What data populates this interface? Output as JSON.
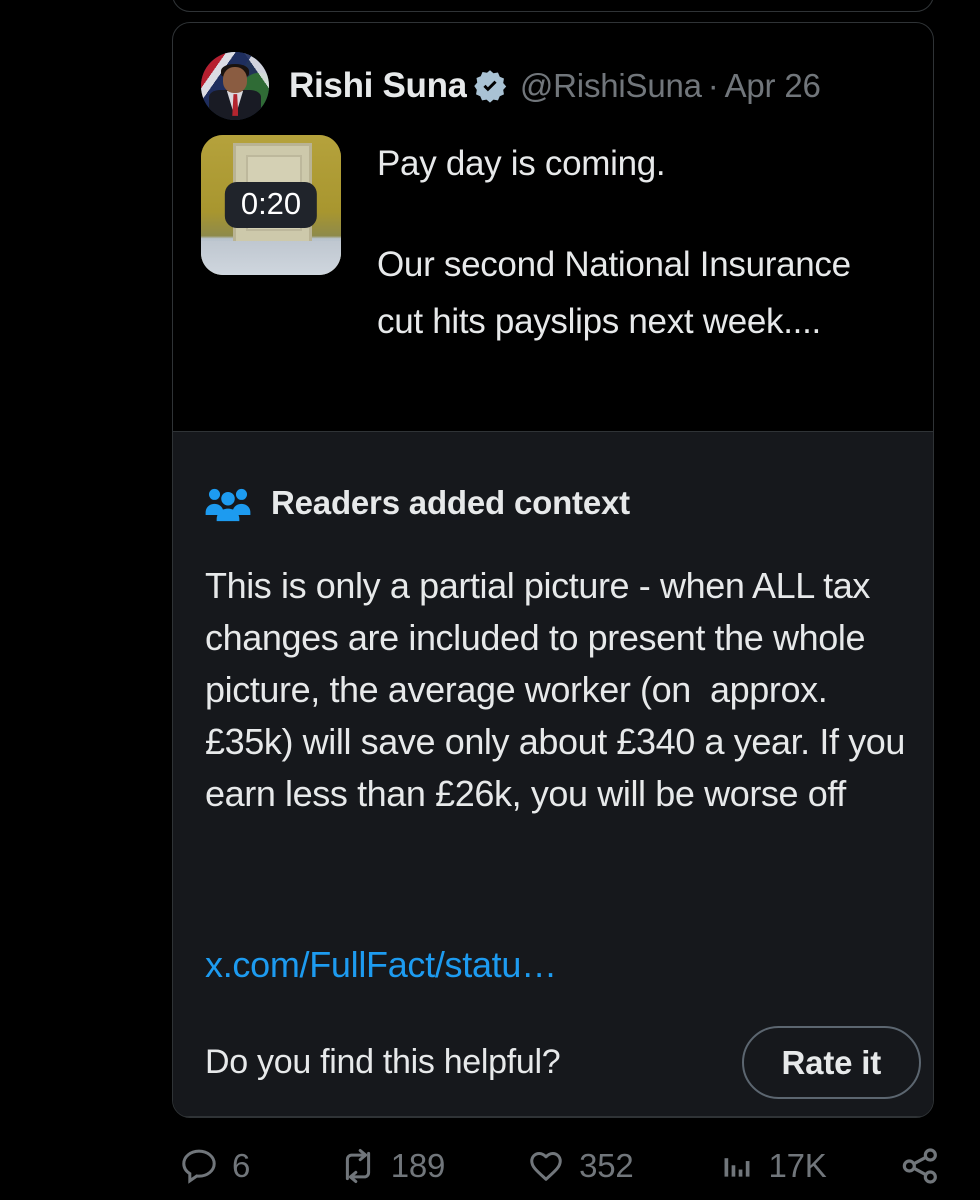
{
  "colors": {
    "background": "#000000",
    "note_background": "#16181c",
    "border": "#2f3336",
    "text_primary": "#e7e9ea",
    "text_secondary": "#71767b",
    "link_blue": "#1d9bf0",
    "note_icon_blue": "#1d9bf0",
    "verified_badge": "#a9c2d4"
  },
  "tweet": {
    "author": {
      "display_name": "Rishi Suna",
      "handle": "@RishiSuna",
      "verified": true,
      "verified_icon": "verified-badge-icon",
      "avatar_alt": "avatar"
    },
    "separator": "·",
    "timestamp": "Apr 26",
    "media": {
      "type": "video",
      "duration": "0:20",
      "thumbnail_alt": "video-thumbnail"
    },
    "text_line_1": "Pay day is coming.",
    "text_line_2": "Our second National Insurance cut hits payslips next week...."
  },
  "community_note": {
    "icon": "people-group-icon",
    "title": "Readers added context",
    "body": "This is only a partial picture - when ALL tax changes are included to present the whole picture, the average worker (on  approx. £35k) will save only about £340 a year. If you earn less than £26k, you will be worse off",
    "source_link": "x.com/FullFact/statu…",
    "helpful_prompt": "Do you find this helpful?",
    "rate_button_label": "Rate it"
  },
  "actions": {
    "reply": {
      "icon": "reply-icon",
      "count": "6"
    },
    "retweet": {
      "icon": "retweet-icon",
      "count": "189"
    },
    "like": {
      "icon": "heart-icon",
      "count": "352"
    },
    "views": {
      "icon": "analytics-bar-icon",
      "count": "17K"
    },
    "share": {
      "icon": "share-icon",
      "count": ""
    }
  }
}
